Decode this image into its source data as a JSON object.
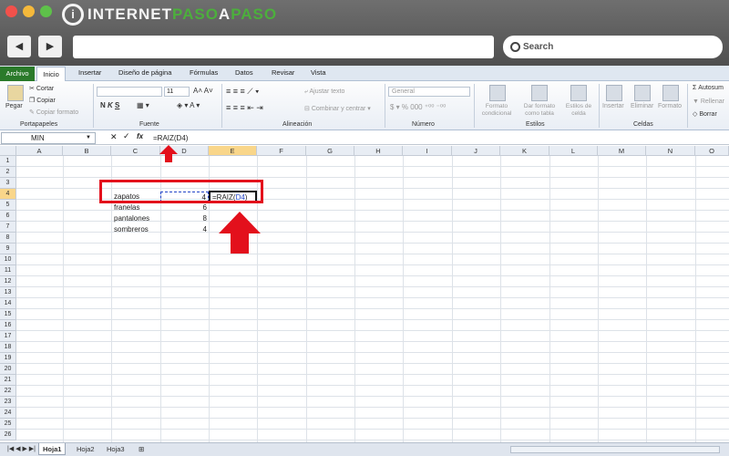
{
  "brand": {
    "part1": "INTERNET",
    "part2": "PASO",
    "part3": "A",
    "part4": "PASO",
    "logo": "i"
  },
  "browser": {
    "back_icon": "◀",
    "forward_icon": "▶",
    "search_label": "Search",
    "search_icon": "search-icon"
  },
  "ribbon_tabs": [
    "Archivo",
    "Inicio",
    "Insertar",
    "Diseño de página",
    "Fórmulas",
    "Datos",
    "Revisar",
    "Vista"
  ],
  "ribbon": {
    "portapapeles": {
      "pegar": "Pegar",
      "cortar": "Cortar",
      "copiar": "Copiar",
      "copiar_formato": "Copiar formato",
      "label": "Portapapeles"
    },
    "fuente": {
      "label": "Fuente",
      "size": "11"
    },
    "alineacion": {
      "ajustar": "Ajustar texto",
      "combinar": "Combinar y centrar",
      "label": "Alineación"
    },
    "numero": {
      "format": "General",
      "label": "Número"
    },
    "estilos": {
      "formato_cond": "Formato condicional",
      "dar_formato": "Dar formato como tabla",
      "estilos_celda": "Estilos de celda",
      "label": "Estilos"
    },
    "celdas": {
      "insertar": "Insertar",
      "eliminar": "Eliminar",
      "formato": "Formato",
      "label": "Celdas"
    },
    "modificar": {
      "autosum": "Autosum",
      "rellenar": "Rellenar",
      "borrar": "Borrar"
    }
  },
  "formula_bar": {
    "name_box": "MIN",
    "cancel": "✕",
    "enter": "✓",
    "fx": "fx",
    "formula": "=RAIZ(D4)"
  },
  "columns": [
    "A",
    "B",
    "C",
    "D",
    "E",
    "F",
    "G",
    "H",
    "I",
    "J",
    "K",
    "L",
    "M",
    "N",
    "O"
  ],
  "rows": [
    "1",
    "2",
    "3",
    "4",
    "5",
    "6",
    "7",
    "8",
    "9",
    "10",
    "11",
    "12",
    "13",
    "14",
    "15",
    "16",
    "17",
    "18",
    "19",
    "20",
    "21",
    "22",
    "23",
    "24",
    "25",
    "26"
  ],
  "cells": {
    "c4": "zapatos",
    "d4": "4",
    "c5": "franelas",
    "d5": "6",
    "c6": "pantalones",
    "d6": "8",
    "c7": "sombreros",
    "d7": "4",
    "e4_prefix": "=RAIZ(",
    "e4_ref": "D4",
    "e4_suffix": ")"
  },
  "sheets": [
    "Hoja1",
    "Hoja2",
    "Hoja3"
  ],
  "colors": {
    "highlight": "#e3101c",
    "ref_blue": "#2446c8",
    "archivo": "#2a7a2a",
    "selected_header": "#f9d68a"
  }
}
